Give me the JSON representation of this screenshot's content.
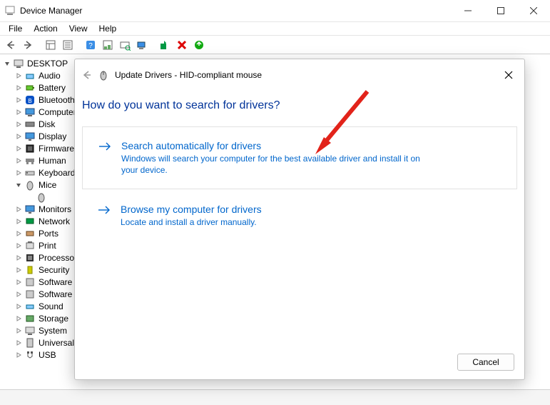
{
  "window": {
    "title": "Device Manager"
  },
  "menu": {
    "file": "File",
    "action": "Action",
    "view": "View",
    "help": "Help"
  },
  "tree": {
    "root": "DESKTOP",
    "items": [
      {
        "label": "Audio"
      },
      {
        "label": "Battery"
      },
      {
        "label": "Bluetooth"
      },
      {
        "label": "Computer"
      },
      {
        "label": "Disk"
      },
      {
        "label": "Display"
      },
      {
        "label": "Firmware"
      },
      {
        "label": "Human"
      },
      {
        "label": "Keyboards"
      },
      {
        "label": "Mice",
        "expanded": true
      },
      {
        "label": "Monitors"
      },
      {
        "label": "Network"
      },
      {
        "label": "Ports"
      },
      {
        "label": "Print"
      },
      {
        "label": "Processors"
      },
      {
        "label": "Security"
      },
      {
        "label": "Software"
      },
      {
        "label": "Software"
      },
      {
        "label": "Sound"
      },
      {
        "label": "Storage"
      },
      {
        "label": "System"
      },
      {
        "label": "Universal"
      },
      {
        "label": "USB"
      }
    ],
    "mice_child": ""
  },
  "dialog": {
    "title_small": "Update Drivers - HID-compliant mouse",
    "heading": "How do you want to search for drivers?",
    "option1_title": "Search automatically for drivers",
    "option1_desc": "Windows will search your computer for the best available driver and install it on your device.",
    "option2_title": "Browse my computer for drivers",
    "option2_desc": "Locate and install a driver manually.",
    "cancel": "Cancel"
  }
}
